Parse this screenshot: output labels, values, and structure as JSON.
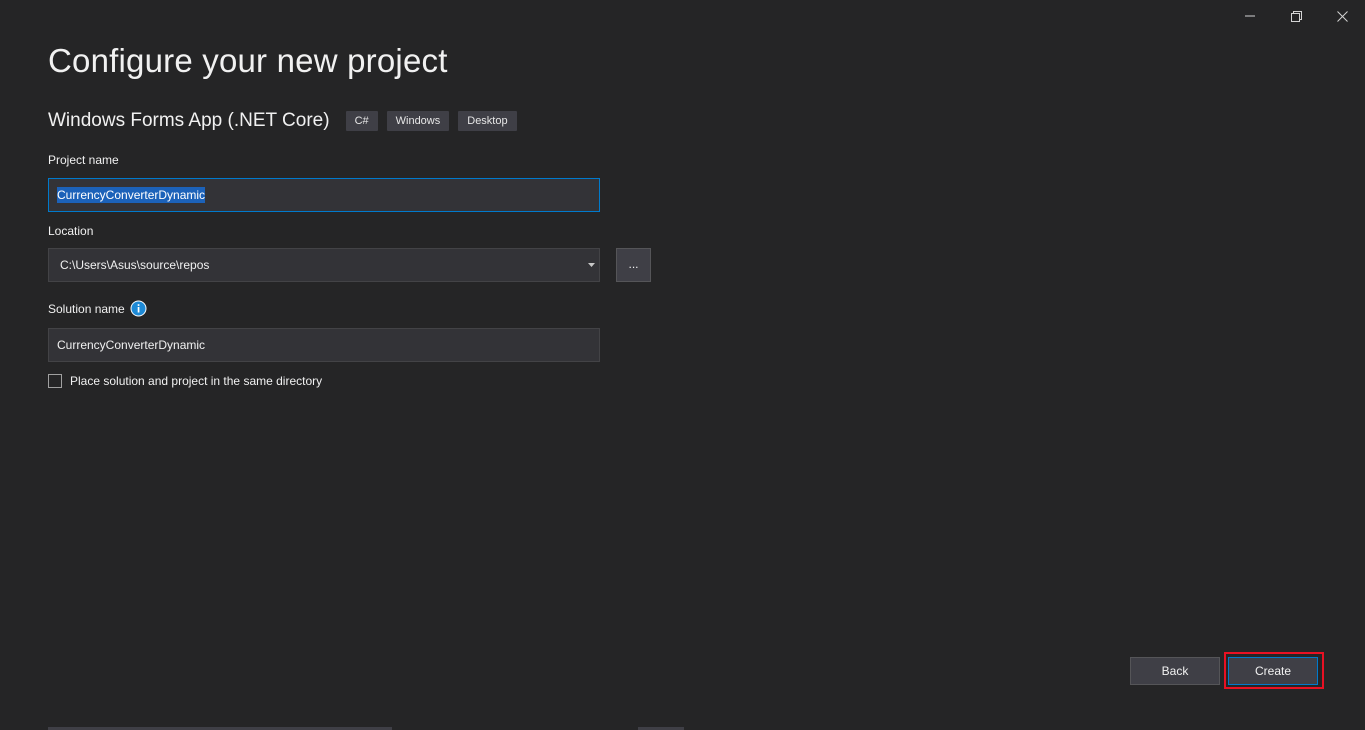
{
  "window": {
    "controls": {
      "minimize": "minimize-icon",
      "restore": "restore-icon",
      "close": "close-icon"
    }
  },
  "page": {
    "title": "Configure your new project"
  },
  "template": {
    "name": "Windows Forms App (.NET Core)",
    "tags": [
      "C#",
      "Windows",
      "Desktop"
    ]
  },
  "form": {
    "project_name": {
      "label": "Project name",
      "value": "CurrencyConverterDynamic"
    },
    "location": {
      "label": "Location",
      "value": "C:\\Users\\Asus\\source\\repos",
      "browse_label": "..."
    },
    "solution_name": {
      "label": "Solution name",
      "value": "CurrencyConverterDynamic",
      "info_icon": "info-icon"
    },
    "same_directory": {
      "label": "Place solution and project in the same directory",
      "checked": false
    }
  },
  "footer": {
    "back_label": "Back",
    "create_label": "Create"
  },
  "colors": {
    "background": "#252526",
    "accent": "#007acc",
    "highlight": "#e81123",
    "input_bg": "#333337",
    "button_bg": "#3f3f46"
  }
}
